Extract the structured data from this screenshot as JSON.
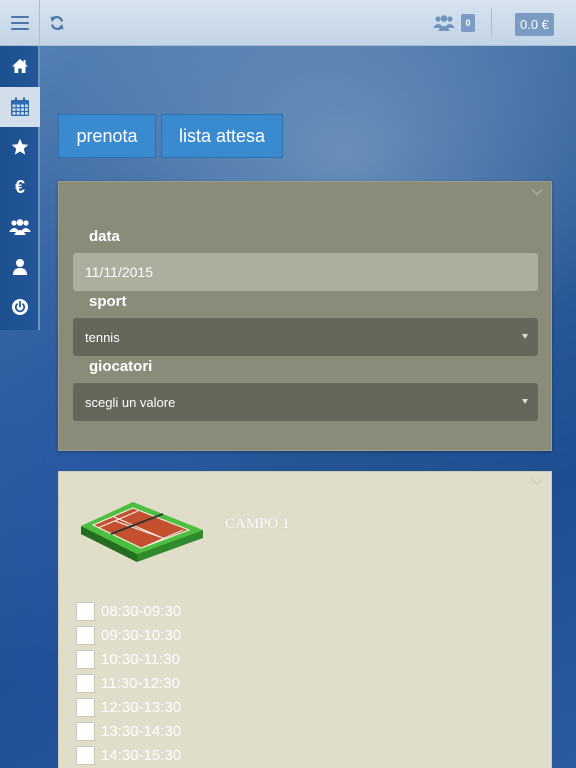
{
  "header": {
    "users_badge": "0",
    "balance": "0.0 €"
  },
  "sidebar": {
    "items": [
      {
        "icon": "home-icon"
      },
      {
        "icon": "calendar-icon",
        "active": true
      },
      {
        "icon": "star-icon"
      },
      {
        "icon": "euro-icon",
        "glyph": "€"
      },
      {
        "icon": "users-icon"
      },
      {
        "icon": "user-icon"
      },
      {
        "icon": "power-icon"
      }
    ]
  },
  "actions": {
    "prenota": "prenota",
    "lista_attesa": "lista attesa"
  },
  "form": {
    "data_label": "data",
    "data_value": "11/11/2015",
    "sport_label": "sport",
    "sport_value": "tennis",
    "giocatori_label": "giocatori",
    "giocatori_value": "scegli un valore"
  },
  "court": {
    "name": "CAMPO 1",
    "slots": [
      "08:30-09:30",
      "09:30-10:30",
      "10:30-11:30",
      "11:30-12:30",
      "12:30-13:30",
      "13:30-14:30",
      "14:30-15:30"
    ]
  },
  "colors": {
    "accent": "#3a8ad0",
    "form_panel": "#8b8b7a",
    "court_panel": "#e0ddcb"
  }
}
